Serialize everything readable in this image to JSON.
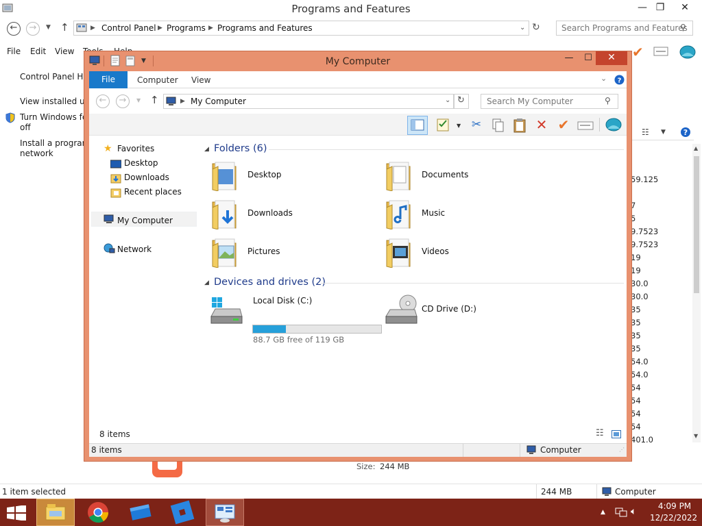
{
  "bg": {
    "title": "Programs and Features",
    "crumbs": [
      "Control Panel",
      "Programs",
      "Programs and Features"
    ],
    "search_placeholder": "Search Programs and Features",
    "menu": [
      "File",
      "Edit",
      "View",
      "Tools",
      "Help"
    ],
    "left": {
      "home": "Control Panel Home",
      "view_updates": "View installed updates",
      "turn_features_1": "Turn Windows features on or",
      "turn_features_2": "off",
      "install_1": "Install a program from the",
      "install_2": "network"
    },
    "numbers": [
      "59.125",
      "7",
      "5",
      "9.7523",
      "9.7523",
      "19",
      "19",
      "30.0",
      "30.0",
      "35",
      "35",
      "35",
      "35",
      "54.0",
      "54.0",
      "54",
      "54",
      "54",
      "54",
      "401.0"
    ],
    "size_label": "Size:",
    "size_value": "244 MB",
    "status_left": "1 item selected",
    "status_size": "244 MB",
    "status_computer": "Computer"
  },
  "mc": {
    "title": "My Computer",
    "tabs": [
      "File",
      "Computer",
      "View"
    ],
    "address": "My Computer",
    "search_placeholder": "Search My Computer",
    "nav": {
      "favorites": "Favorites",
      "desktop": "Desktop",
      "downloads": "Downloads",
      "recent": "Recent places",
      "mycomputer": "My Computer",
      "network": "Network"
    },
    "folders_header": "Folders (6)",
    "folders": [
      "Desktop",
      "Documents",
      "Downloads",
      "Music",
      "Pictures",
      "Videos"
    ],
    "devices_header": "Devices and drives (2)",
    "drives": {
      "c_name": "Local Disk (C:)",
      "c_free": "88.7 GB free of 119 GB",
      "c_used_fraction": 0.255,
      "d_name": "CD Drive (D:)"
    },
    "status_items": "8 items",
    "status_items2": "8 items",
    "status_computer": "Computer"
  },
  "taskbar": {
    "time": "4:09 PM",
    "date": "12/22/2022"
  },
  "colors": {
    "accent": "#1979ca",
    "frame": "#e8916f",
    "taskbar": "#7d2317",
    "close": "#c4442d",
    "drive_fill": "#26a0da"
  }
}
